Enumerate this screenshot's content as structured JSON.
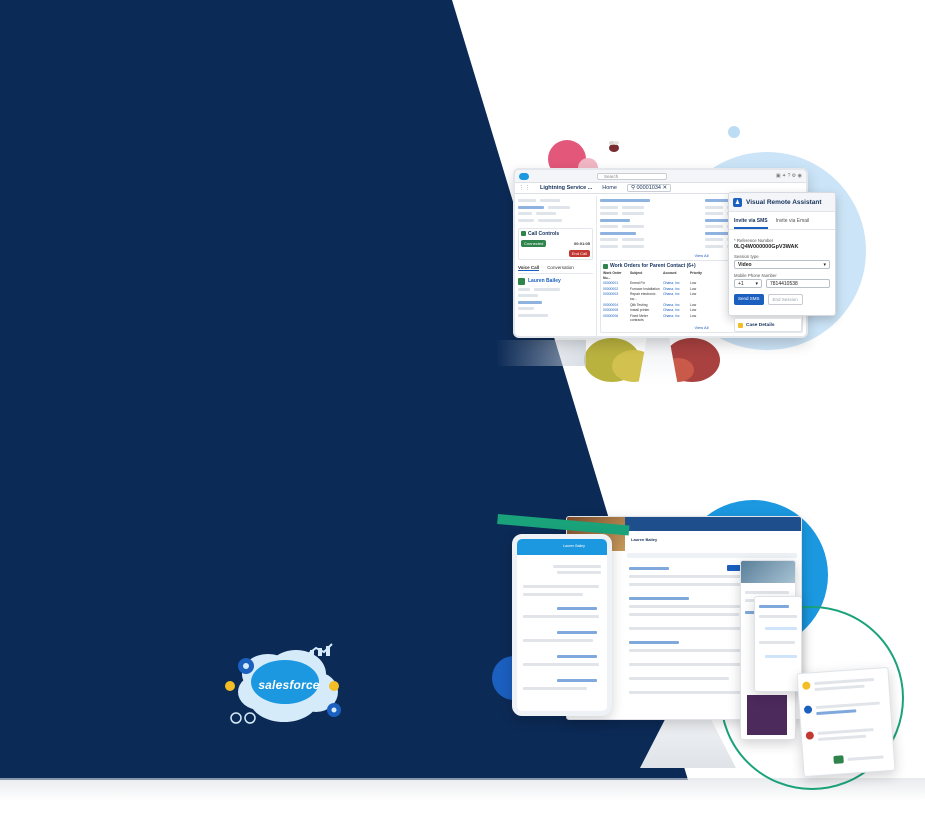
{
  "top_app": {
    "app_name": "Lightning Service ...",
    "home_tab": "Home",
    "search_placeholder": "Search",
    "case_tab": "00001034",
    "call_controls": "Call Controls",
    "call_status": "Connected",
    "call_timer": "00:01:05",
    "end_call": "End Call",
    "voice_call_tab": "Voice Call",
    "conversation_tab": "Conversation",
    "contact_name": "Lauren Bailey",
    "work_orders_title": "Work Orders for Parent Contact (6+)",
    "view_all": "View All",
    "work_order_columns": [
      "Work Order Nu...",
      "Subject",
      "Account",
      "Priority"
    ],
    "work_order_rows": [
      [
        "00000001",
        "Emeal Fix",
        "Ohana, Inc",
        "Low"
      ],
      [
        "00000002",
        "Furnace Installation",
        "Ohana, Inc",
        "Low"
      ],
      [
        "00000003",
        "Repair electronic sw...",
        "Ohana, Inc",
        "Low"
      ],
      [
        "00000004",
        "Qlik Testing",
        "Ohana, Inc",
        "Low"
      ],
      [
        "00000005",
        "Install printer",
        "Ohana, Inc",
        "Low"
      ],
      [
        "00000006",
        "Fixed Meter contracts",
        "Ohana, Inc",
        "Low"
      ]
    ]
  },
  "visual_remote_assistant": {
    "title": "Visual Remote Assistant",
    "tab_sms": "Invite via SMS",
    "tab_email": "Invite via Email",
    "ref_label": "* Reference Number",
    "ref_value": "0LQ4W000000GpV3WAK",
    "session_label": "Session type",
    "session_value": "Video",
    "mobile_label": "Mobile Phone Number",
    "country_code": "+1",
    "phone": "7814410538",
    "send_button": "Send SMS",
    "end_button": "End Session"
  },
  "case_details": "Case Details",
  "bottom_app": {
    "header_title": "Lauren Bailey",
    "tablet_title": "Lauren Bailey"
  },
  "brand": {
    "logo_text": "salesforce"
  },
  "colors": {
    "navy": "#0c2a56",
    "accent_blue": "#1b5fbf",
    "sky": "#cbe4f7",
    "pink": "#e2577a",
    "teal": "#1aa37a",
    "cloud_blue": "#1b98e0"
  }
}
